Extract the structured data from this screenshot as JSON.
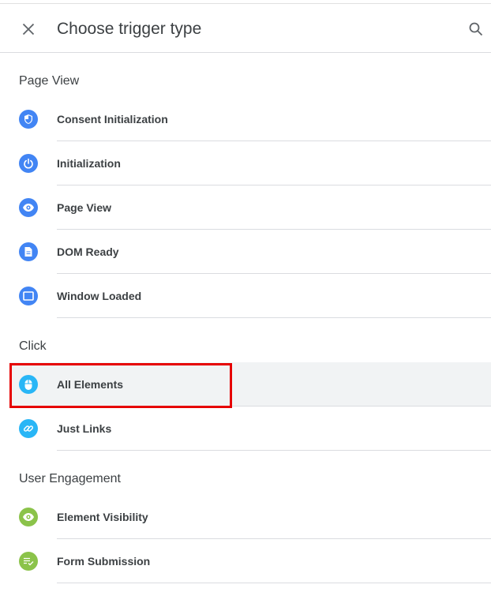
{
  "header": {
    "title": "Choose trigger type"
  },
  "sections": {
    "page_view": {
      "title": "Page View",
      "items": [
        {
          "label": "Consent Initialization",
          "icon": "shield-icon",
          "color": "#4285f4"
        },
        {
          "label": "Initialization",
          "icon": "power-icon",
          "color": "#4285f4"
        },
        {
          "label": "Page View",
          "icon": "eye-icon",
          "color": "#4285f4"
        },
        {
          "label": "DOM Ready",
          "icon": "document-icon",
          "color": "#4285f4"
        },
        {
          "label": "Window Loaded",
          "icon": "window-icon",
          "color": "#4285f4"
        }
      ]
    },
    "click": {
      "title": "Click",
      "items": [
        {
          "label": "All Elements",
          "icon": "mouse-icon",
          "color": "#29b6f6",
          "selected": true
        },
        {
          "label": "Just Links",
          "icon": "link-icon",
          "color": "#29b6f6"
        }
      ]
    },
    "user_engagement": {
      "title": "User Engagement",
      "items": [
        {
          "label": "Element Visibility",
          "icon": "eye-icon",
          "color": "#8bc34a"
        },
        {
          "label": "Form Submission",
          "icon": "form-check-icon",
          "color": "#8bc34a"
        }
      ]
    }
  },
  "colors": {
    "highlight": "#e60000",
    "selected_bg": "#f1f3f4"
  }
}
